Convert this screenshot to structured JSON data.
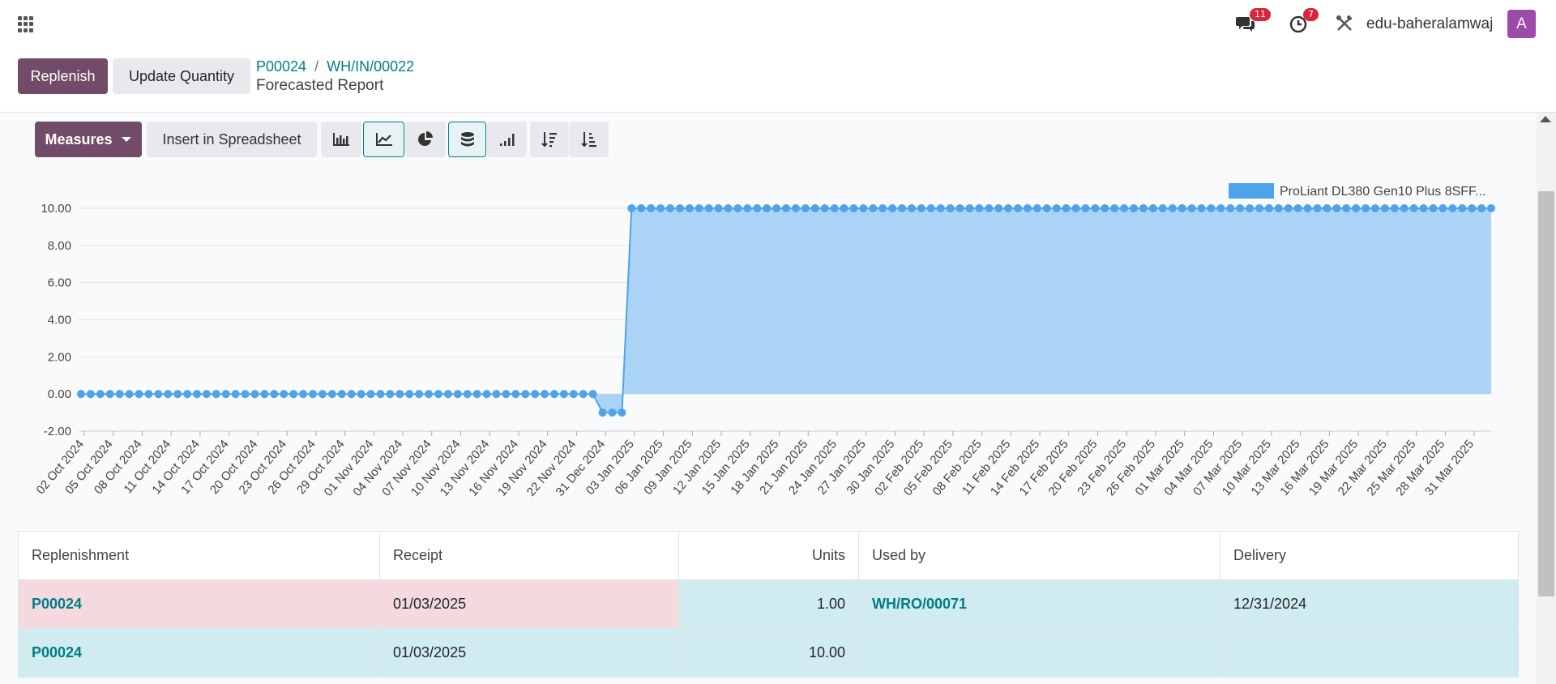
{
  "topbar": {
    "messages_count": "11",
    "activities_count": "7",
    "username": "edu-baheralamwaj",
    "avatar_letter": "A"
  },
  "control": {
    "replenish_label": "Replenish",
    "update_quantity_label": "Update Quantity",
    "breadcrumb": [
      "P00024",
      "WH/IN/00022"
    ],
    "breadcrumb_sep": "/",
    "subtitle": "Forecasted Report"
  },
  "toolbar": {
    "measures_label": "Measures",
    "insert_label": "Insert in Spreadsheet",
    "icons": [
      "bar-chart-icon",
      "line-chart-icon",
      "pie-chart-icon",
      "stacked-icon",
      "cumulative-icon",
      "sort-desc-icon",
      "sort-asc-icon"
    ]
  },
  "colors": {
    "primary": "#714b67",
    "link": "#017e84",
    "series": "#4fa3ea",
    "series_fill": "#a7d1f5"
  },
  "chart_data": {
    "type": "line",
    "title": "",
    "xlabel": "",
    "ylabel": "",
    "ylim": [
      -2,
      10
    ],
    "yticks": [
      "-2.00",
      "0.00",
      "2.00",
      "4.00",
      "6.00",
      "8.00",
      "10.00"
    ],
    "legend": "top-right",
    "grid": true,
    "area_fill": true,
    "x_tick_labels": [
      "02 Oct 2024",
      "05 Oct 2024",
      "08 Oct 2024",
      "11 Oct 2024",
      "14 Oct 2024",
      "17 Oct 2024",
      "20 Oct 2024",
      "23 Oct 2024",
      "26 Oct 2024",
      "29 Oct 2024",
      "01 Nov 2024",
      "04 Nov 2024",
      "07 Nov 2024",
      "10 Nov 2024",
      "13 Nov 2024",
      "16 Nov 2024",
      "19 Nov 2024",
      "22 Nov 2024",
      "31 Dec 2024",
      "03 Jan 2025",
      "06 Jan 2025",
      "09 Jan 2025",
      "12 Jan 2025",
      "15 Jan 2025",
      "18 Jan 2025",
      "21 Jan 2025",
      "24 Jan 2025",
      "27 Jan 2025",
      "30 Jan 2025",
      "02 Feb 2025",
      "05 Feb 2025",
      "08 Feb 2025",
      "11 Feb 2025",
      "14 Feb 2025",
      "17 Feb 2025",
      "20 Feb 2025",
      "23 Feb 2025",
      "26 Feb 2025",
      "01 Mar 2025",
      "04 Mar 2025",
      "07 Mar 2025",
      "10 Mar 2025",
      "13 Mar 2025",
      "16 Mar 2025",
      "19 Mar 2025",
      "22 Mar 2025",
      "25 Mar 2025",
      "28 Mar 2025",
      "31 Mar 2025"
    ],
    "series": [
      {
        "name": "ProLiant DL380 Gen10 Plus 8SFF...",
        "segments": [
          {
            "count": 54,
            "value": 0
          },
          {
            "count": 3,
            "value": -1
          },
          {
            "count": 90,
            "value": 10
          }
        ]
      }
    ]
  },
  "table": {
    "headers": [
      "Replenishment",
      "Receipt",
      "Units",
      "Used by",
      "Delivery"
    ],
    "rows": [
      {
        "replenishment": "P00024",
        "receipt": "01/03/2025",
        "units": "1.00",
        "used_by": "WH/RO/00071",
        "delivery": "12/31/2024"
      },
      {
        "replenishment": "P00024",
        "receipt": "01/03/2025",
        "units": "10.00",
        "used_by": "",
        "delivery": ""
      }
    ]
  }
}
